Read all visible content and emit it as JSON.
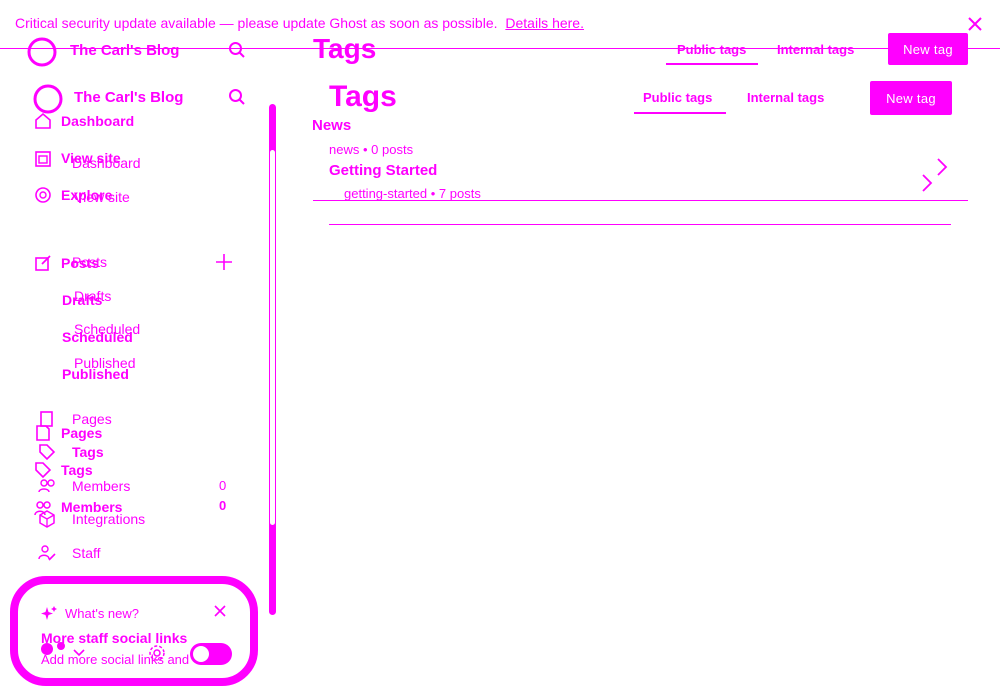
{
  "banner": {
    "text": "Critical security update available — please update Ghost as soon as possible.",
    "link": "Details here."
  },
  "header_ghost": {
    "site_title": "The Carl's Blog",
    "page_title": "Tags",
    "tab_public": "Public tags",
    "tab_internal": "Internal tags",
    "new_tag": "New tag"
  },
  "header": {
    "site_title": "The Carl's Blog",
    "page_title": "Tags",
    "tab_public": "Public tags",
    "tab_internal": "Internal tags",
    "new_tag": "New tag"
  },
  "sidebar_ghost": {
    "dashboard": "Dashboard",
    "view_site": "View site",
    "explore": "Explore",
    "posts": "Posts",
    "drafts": "Drafts",
    "scheduled": "Scheduled",
    "published": "Published",
    "pages": "Pages",
    "tags": "Tags",
    "members": "Members",
    "members_count": "0"
  },
  "sidebar": {
    "dashboard": "Dashboard",
    "view_site": "View site",
    "posts": "Posts",
    "drafts": "Drafts",
    "scheduled": "Scheduled",
    "published": "Published",
    "pages": "Pages",
    "tags": "Tags",
    "members": "Members",
    "members_count": "0",
    "integrations": "Integrations",
    "staff": "Staff"
  },
  "whats_new": {
    "title": "What's new?",
    "headline": "More staff social links",
    "body": "Add more social links and"
  },
  "tags_list": [
    {
      "name": "News",
      "slug": "news",
      "count": "0 posts"
    },
    {
      "name": "Getting Started",
      "slug": "getting-started",
      "count": "7 posts"
    }
  ],
  "colors": {
    "accent": "#ff00ff",
    "background": "#ffffff"
  }
}
